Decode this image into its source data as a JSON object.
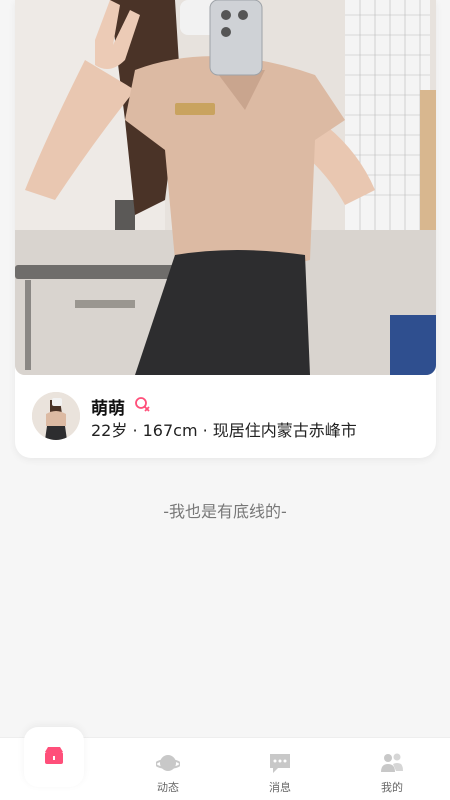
{
  "profile": {
    "name": "萌萌",
    "details": "22岁 · 167cm · 现居住内蒙古赤峰市",
    "gender_icon": "female-icon"
  },
  "footer_note": "-我也是有底线的-",
  "tabbar": {
    "items": [
      {
        "label": "",
        "icon": "home-icon",
        "active": true
      },
      {
        "label": "动态",
        "icon": "planet-icon"
      },
      {
        "label": "消息",
        "icon": "message-icon"
      },
      {
        "label": "我的",
        "icon": "users-icon"
      }
    ]
  },
  "colors": {
    "accent": "#ff4f7a",
    "background": "#f6f6f6",
    "card": "#ffffff",
    "muted_icon": "#c8c8c8"
  }
}
